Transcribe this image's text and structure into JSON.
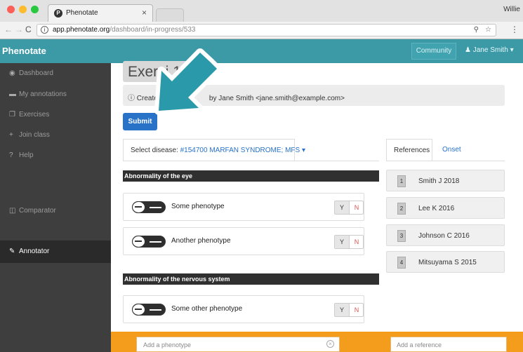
{
  "browser": {
    "tab_title": "Phenotate",
    "tab_favicon": "P",
    "profile_name": "Willie",
    "url_domain": "app.phenotate.org",
    "url_path": "/dashboard/in-progress/533"
  },
  "app": {
    "brand": "Phenotate",
    "community_label": "Community",
    "user_label": "Jane Smith",
    "accent_color": "#3c9aa7"
  },
  "sidebar": {
    "items": [
      {
        "label": "Dashboard",
        "icon": "dashboard-icon"
      },
      {
        "label": "My annotations",
        "icon": "folder-icon"
      },
      {
        "label": "Exercises",
        "icon": "copy-icon"
      },
      {
        "label": "Join class",
        "icon": "plus-icon"
      },
      {
        "label": "Help",
        "icon": "question-icon"
      },
      {
        "label": "Annotator",
        "icon": "pencil-icon"
      },
      {
        "label": "Comparator",
        "icon": "columns-icon"
      }
    ]
  },
  "main": {
    "title_visible": "Exerci",
    "title_suffix": "1",
    "created_prefix": "Created",
    "created_suffix": "by Jane Smith <jane.smith@example.com>",
    "submit_label": "Submit",
    "disease_label": "Select disease:",
    "disease_value": "#154700 MARFAN SYNDROME; MFS",
    "sections": [
      {
        "heading": "Abnormality of the eye",
        "phenotypes": [
          {
            "label": "Some phenotype",
            "yes": "Y",
            "no": "N"
          },
          {
            "label": "Another phenotype",
            "yes": "Y",
            "no": "N"
          }
        ]
      },
      {
        "heading": "Abnormality of the nervous system",
        "phenotypes": [
          {
            "label": "Some other phenotype",
            "yes": "Y",
            "no": "N"
          }
        ]
      }
    ]
  },
  "references_panel": {
    "tabs": [
      "References",
      "Onset"
    ],
    "items": [
      {
        "num": "1",
        "label": "Smith J 2018"
      },
      {
        "num": "2",
        "label": "Lee K 2016"
      },
      {
        "num": "3",
        "label": "Johnson C 2016"
      },
      {
        "num": "4",
        "label": "Mitsuyama S 2015"
      }
    ]
  },
  "footer": {
    "phenotype_placeholder": "Add a phenotype",
    "reference_placeholder": "Add a reference",
    "color": "#f49c1b"
  },
  "overlay": {
    "arrow_color": "#2a9aaa"
  }
}
